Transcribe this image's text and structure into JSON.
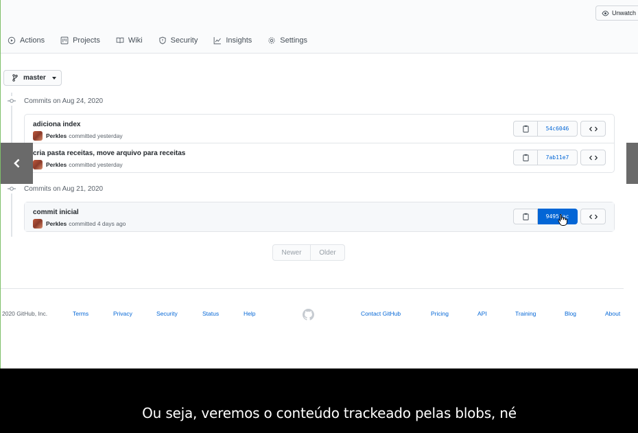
{
  "header": {
    "watch_label": "Unwatch"
  },
  "tabs": [
    {
      "label": "Actions",
      "icon": "play-circle-icon"
    },
    {
      "label": "Projects",
      "icon": "project-icon"
    },
    {
      "label": "Wiki",
      "icon": "book-icon"
    },
    {
      "label": "Security",
      "icon": "shield-icon"
    },
    {
      "label": "Insights",
      "icon": "graph-icon"
    },
    {
      "label": "Settings",
      "icon": "gear-icon"
    }
  ],
  "branch": {
    "label": "master"
  },
  "commit_groups": [
    {
      "heading": "Commits on Aug 24, 2020",
      "commits": [
        {
          "message": "adiciona index",
          "author": "Perkles",
          "when": "committed yesterday",
          "sha": "54c6046"
        },
        {
          "message": "cria pasta receitas, move arquivo para receitas",
          "author": "Perkles",
          "when": "committed yesterday",
          "sha": "7ab11e7"
        }
      ]
    },
    {
      "heading": "Commits on Aug 21, 2020",
      "commits": [
        {
          "message": "commit inicial",
          "author": "Perkles",
          "when": "committed 4 days ago",
          "sha": "9495fac"
        }
      ]
    }
  ],
  "pagination": {
    "newer": "Newer",
    "older": "Older"
  },
  "footer": {
    "copyright": "2020 GitHub, Inc.",
    "left_links": [
      "Terms",
      "Privacy",
      "Security",
      "Status",
      "Help"
    ],
    "right_links": [
      "Contact GitHub",
      "Pricing",
      "API",
      "Training",
      "Blog",
      "About"
    ]
  },
  "caption": "Ou seja, veremos o conteúdo trackeado pelas blobs, né",
  "colors": {
    "link": "#0366d6",
    "active_sha_bg": "#0366d6",
    "caption_bg": "#000000"
  }
}
